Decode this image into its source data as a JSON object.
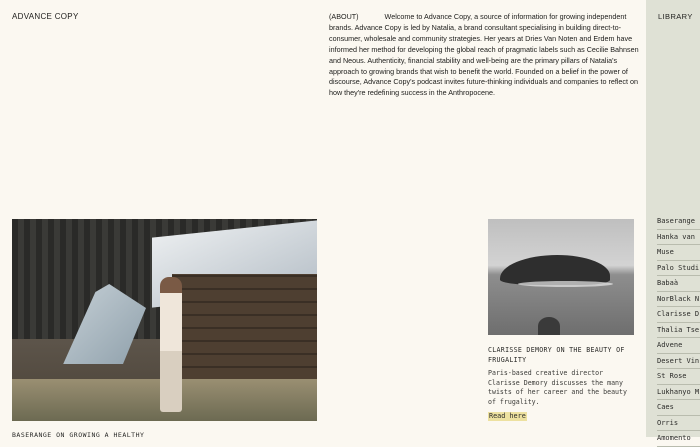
{
  "header": {
    "brand": "ADVANCE COPY"
  },
  "about": {
    "tag": "(ABOUT)",
    "text": "Welcome to Advance Copy, a source of information for growing independent brands. Advance Copy is led by Natalia, a brand consultant specialising in building direct-to-consumer, wholesale and community strategies. Her years at Dries Van Noten and Erdem have informed her method for developing the global reach of pragmatic labels such as Cecilie Bahnsen and Neous. Authenticity, financial stability and well-being are the primary pillars of Natalia's approach to growing brands that wish to benefit the world. Founded on a belief in the power of discourse, Advance Copy's podcast invites future-thinking individuals and companies to reflect on how they're redefining success in the Anthropocene."
  },
  "library": {
    "title": "LIBRARY",
    "items": [
      "Baserange",
      "Hanka van",
      "Muse",
      "Palo Studi",
      "Babaà",
      "NorBlack N",
      "Clarisse D",
      "Thalia Tse",
      "Advene",
      "Desert Vin",
      "St Rose",
      "Lukhanyo M",
      "Caes",
      "Orris",
      "Amomento"
    ]
  },
  "feature": {
    "caption": "BASERANGE ON GROWING A HEALTHY"
  },
  "article": {
    "title": "CLARISSE DEMORY ON THE BEAUTY OF FRUGALITY",
    "description": "Paris-based creative director Clarisse Demory discusses the many twists of her career and the beauty of frugality.",
    "link": "Read here"
  }
}
